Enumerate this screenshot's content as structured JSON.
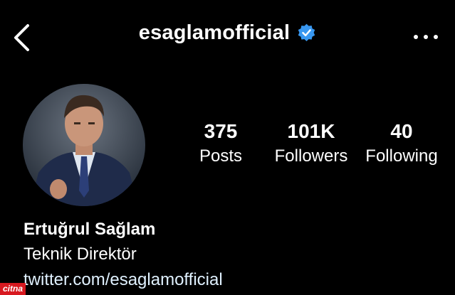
{
  "header": {
    "username": "esaglamofficial",
    "verified": true,
    "back_icon": "chevron-left-icon",
    "more_icon": "more-horizontal-icon"
  },
  "profile": {
    "stats": {
      "posts": {
        "value": "375",
        "label": "Posts"
      },
      "followers": {
        "value": "101K",
        "label": "Followers"
      },
      "following": {
        "value": "40",
        "label": "Following"
      }
    },
    "bio": {
      "name": "Ertuğrul Sağlam",
      "title": "Teknik Direktör",
      "link": "twitter.com/esaglamofficial"
    }
  },
  "watermark": "citna",
  "colors": {
    "background": "#000000",
    "text": "#ffffff",
    "verified": "#3897f0",
    "link": "#e0f1ff",
    "watermark_bg": "#d71920"
  }
}
